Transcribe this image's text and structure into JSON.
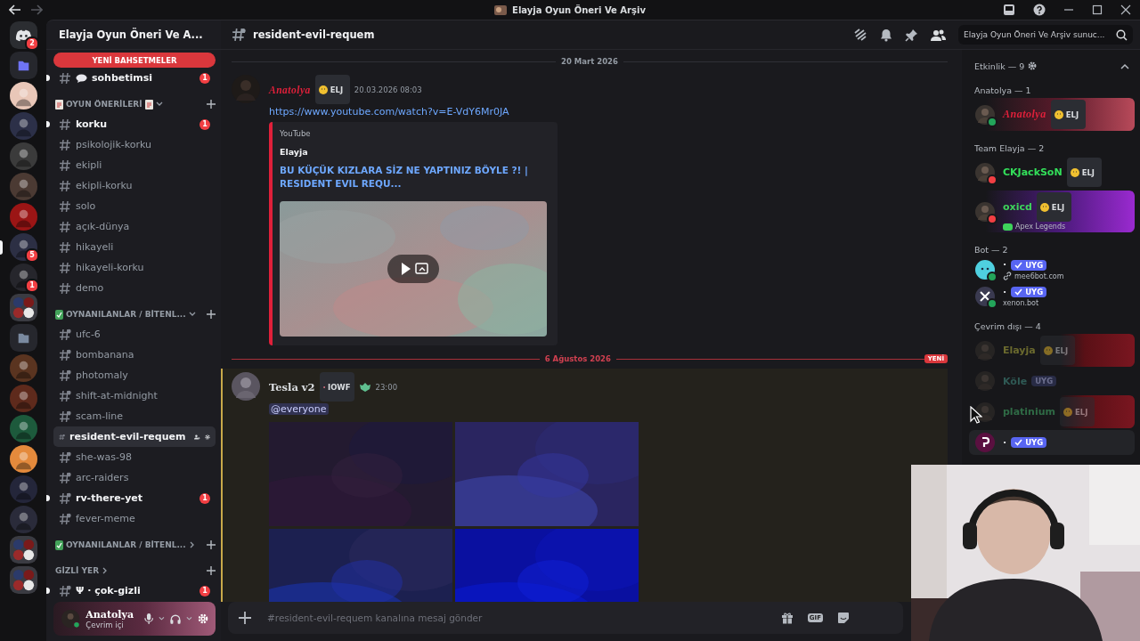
{
  "window": {
    "title": "Elayja Oyun Öneri Ve Arşiv"
  },
  "servers": [
    {
      "kind": "home",
      "badge": "2",
      "selected": false
    },
    {
      "kind": "folder",
      "selected": false
    },
    {
      "kind": "server",
      "selected": false
    },
    {
      "kind": "server",
      "selected": false
    },
    {
      "kind": "server",
      "selected": false
    },
    {
      "kind": "server",
      "selected": false
    },
    {
      "kind": "server",
      "selected": false
    },
    {
      "kind": "server",
      "badge": "5",
      "selected": true
    },
    {
      "kind": "server",
      "badge": "1",
      "selected": false
    },
    {
      "kind": "group",
      "selected": false
    },
    {
      "kind": "folder",
      "selected": false
    },
    {
      "kind": "server",
      "selected": false
    },
    {
      "kind": "server",
      "selected": false
    },
    {
      "kind": "server",
      "selected": false
    },
    {
      "kind": "server",
      "selected": false
    },
    {
      "kind": "server",
      "selected": false
    },
    {
      "kind": "server",
      "selected": false
    },
    {
      "kind": "group",
      "selected": false
    },
    {
      "kind": "group",
      "selected": false
    }
  ],
  "sidebar": {
    "server_name": "Elayja Oyun Öneri Ve A...",
    "mentions_pill": "YENİ BAHSETMELER",
    "sections": [
      {
        "channels": [
          {
            "name": "sohbetimsi",
            "kind": "chat",
            "unread": true,
            "badge": "1",
            "selected": false
          }
        ]
      },
      {
        "category": "OYUN ÖNERİLERİ",
        "expanded": true,
        "channels": [
          {
            "name": "korku",
            "kind": "text",
            "unread": true,
            "badge": "1",
            "selected": false
          },
          {
            "name": "psikolojik-korku",
            "kind": "text",
            "unread": false,
            "selected": false
          },
          {
            "name": "ekipli",
            "kind": "text",
            "unread": false,
            "selected": false
          },
          {
            "name": "ekipli-korku",
            "kind": "text",
            "unread": false,
            "selected": false
          },
          {
            "name": "solo",
            "kind": "text",
            "unread": false,
            "selected": false
          },
          {
            "name": "açık-dünya",
            "kind": "text",
            "unread": false,
            "selected": false
          },
          {
            "name": "hikayeli",
            "kind": "text",
            "unread": false,
            "selected": false
          },
          {
            "name": "hikayeli-korku",
            "kind": "text",
            "unread": false,
            "selected": false
          },
          {
            "name": "demo",
            "kind": "text",
            "unread": false,
            "selected": false
          }
        ]
      },
      {
        "category": "OYNANILANLAR / BİTENL...",
        "expanded": true,
        "channels": [
          {
            "name": "ufc-6",
            "kind": "private",
            "unread": false,
            "selected": false
          },
          {
            "name": "bombanana",
            "kind": "private",
            "unread": false,
            "selected": false
          },
          {
            "name": "photomaly",
            "kind": "private",
            "unread": false,
            "selected": false
          },
          {
            "name": "shift-at-midnight",
            "kind": "private",
            "unread": false,
            "selected": false
          },
          {
            "name": "scam-line",
            "kind": "private",
            "unread": false,
            "selected": false
          },
          {
            "name": "resident-evil-requem",
            "kind": "private",
            "unread": false,
            "selected": true
          },
          {
            "name": "she-was-98",
            "kind": "private",
            "unread": false,
            "selected": false
          },
          {
            "name": "arc-raiders",
            "kind": "private",
            "unread": false,
            "selected": false
          },
          {
            "name": "rv-there-yet",
            "kind": "private",
            "unread": true,
            "badge": "1",
            "selected": false
          },
          {
            "name": "fever-meme",
            "kind": "private",
            "unread": false,
            "selected": false
          }
        ]
      },
      {
        "category": "OYNANILANLAR / BİTENL...",
        "expanded": false
      },
      {
        "category": "GİZLİ YER",
        "expanded": false,
        "channels": [
          {
            "name": "Ψ · çok-gizli",
            "kind": "private",
            "unread": true,
            "badge": "1",
            "selected": false
          }
        ]
      }
    ],
    "user": {
      "name": "Anatolya",
      "status": "Çevrim içi"
    }
  },
  "channel_header": {
    "name": "resident-evil-requem",
    "search_placeholder": "Elayja Oyun Öneri Ve Arşiv sunuc..."
  },
  "messages": [
    {
      "kind": "divider",
      "text": "20 Mart 2026",
      "new": false
    },
    {
      "kind": "message",
      "author": "Anatolya",
      "color": "#e0203a",
      "tag": "ELJ",
      "time": "20.03.2026 08:03",
      "mention": false,
      "link": "https://www.youtube.com/watch?v=E-VdY6Mr0JA",
      "embed": {
        "provider": "YouTube",
        "author": "Elayja",
        "title": "BU KÜÇÜK KIZLARA SİZ NE YAPTINIZ BÖYLE ?! | RESIDENT EVIL REQU..."
      }
    },
    {
      "kind": "divider",
      "text": "6 Ağustos 2026",
      "new": true,
      "new_label": "YENİ"
    },
    {
      "kind": "message",
      "author": "Tesla v2",
      "tag": "IOWF",
      "time": "23:00",
      "mention": true,
      "text": "@everyone"
    }
  ],
  "composer": {
    "placeholder": "#resident-evil-requem kanalına mesaj gönder",
    "gif_label": "GIF"
  },
  "members": {
    "activity": "Etkinlik — 9",
    "groups": [
      {
        "title": "Anatolya — 1",
        "items": [
          {
            "name": "Anatolya",
            "kind": "sakura",
            "color": "#e0203a",
            "dnd": false,
            "tag": {
              "kind": "server",
              "text": "ELJ"
            },
            "offline": false,
            "hovered": false
          }
        ]
      },
      {
        "title": "Team Elayja — 2",
        "items": [
          {
            "name": "CKJackSoN",
            "kind": "plain",
            "color": "#33e05a",
            "dnd": true,
            "tag": {
              "kind": "server",
              "text": "ELJ"
            },
            "offline": false,
            "hovered": false
          },
          {
            "name": "oxicd",
            "kind": "galaxy",
            "color": "#3ed35b",
            "dnd": true,
            "tag": {
              "kind": "server",
              "text": "ELJ"
            },
            "activity": "Apex Legends",
            "offline": false,
            "hovered": false
          }
        ]
      },
      {
        "title": "Bot — 2",
        "items": [
          {
            "name": "·",
            "kind": "plain",
            "dnd": false,
            "tag": {
              "kind": "app",
              "text": "UYG"
            },
            "sub": "mee6bot.com",
            "sub_link": true,
            "offline": false,
            "hovered": false
          },
          {
            "name": "·",
            "kind": "plain",
            "dnd": false,
            "tag": {
              "kind": "app",
              "text": "UYG"
            },
            "sub": "xenon.bot",
            "offline": false,
            "hovered": false
          }
        ]
      },
      {
        "title": "Çevrim dışı — 4",
        "items": [
          {
            "name": "Elayja",
            "kind": "flag",
            "color": "#6b6a2e",
            "tag": {
              "kind": "server",
              "text": "ELJ"
            },
            "offline": true,
            "hovered": false
          },
          {
            "name": "Köle",
            "kind": "plain",
            "color": "#2f5a55",
            "tag": {
              "kind": "app_plain",
              "text": "UYG"
            },
            "offline": true,
            "hovered": false
          },
          {
            "name": "platinium",
            "kind": "flag",
            "color": "#2f6a45",
            "tag": {
              "kind": "server",
              "text": "ELJ"
            },
            "offline": true,
            "hovered": false
          },
          {
            "name": "·",
            "kind": "plain",
            "tag": {
              "kind": "app",
              "text": "UYG"
            },
            "offline": false,
            "hovered": true
          }
        ]
      }
    ]
  }
}
